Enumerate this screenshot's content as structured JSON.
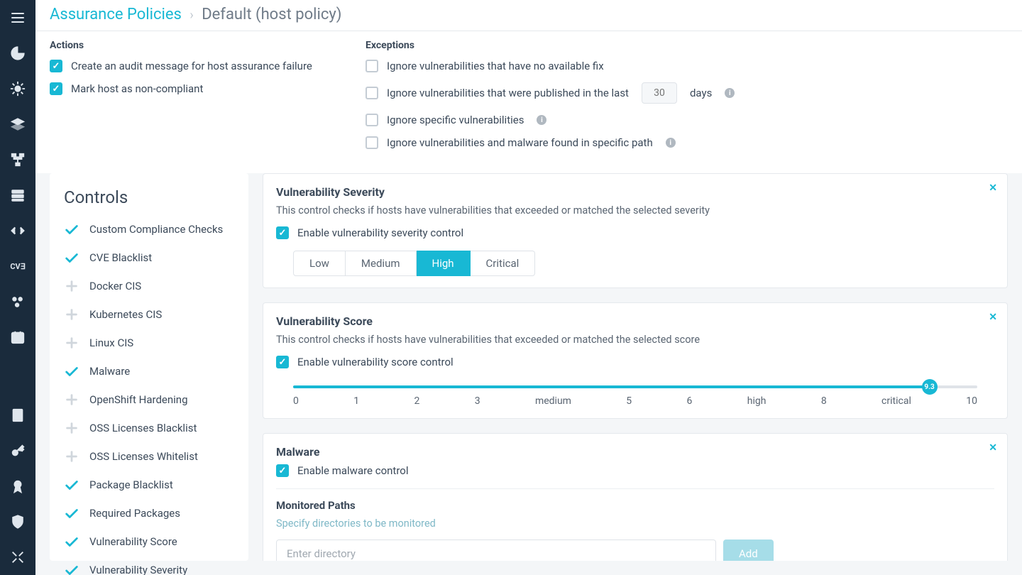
{
  "breadcrumb": {
    "root": "Assurance Policies",
    "current": "Default (host policy)"
  },
  "actions": {
    "heading": "Actions",
    "items": [
      {
        "label": "Create an audit message for host assurance failure",
        "checked": true
      },
      {
        "label": "Mark host as non-compliant",
        "checked": true
      }
    ]
  },
  "exceptions": {
    "heading": "Exceptions",
    "items": [
      {
        "label": "Ignore vulnerabilities that have no available fix",
        "checked": false
      },
      {
        "label_pre": "Ignore vulnerabilities that were published in the last",
        "days_placeholder": "30",
        "label_post": "days",
        "checked": false,
        "has_days": true,
        "has_info": true
      },
      {
        "label": "Ignore specific vulnerabilities",
        "checked": false,
        "has_info": true
      },
      {
        "label": "Ignore vulnerabilities and malware found in specific path",
        "checked": false,
        "has_info": true
      }
    ]
  },
  "controls_panel": {
    "heading": "Controls",
    "items": [
      {
        "label": "Custom Compliance Checks",
        "enabled": true
      },
      {
        "label": "CVE Blacklist",
        "enabled": true
      },
      {
        "label": "Docker CIS",
        "enabled": false
      },
      {
        "label": "Kubernetes CIS",
        "enabled": false
      },
      {
        "label": "Linux CIS",
        "enabled": false
      },
      {
        "label": "Malware",
        "enabled": true
      },
      {
        "label": "OpenShift Hardening",
        "enabled": false
      },
      {
        "label": "OSS Licenses Blacklist",
        "enabled": false
      },
      {
        "label": "OSS Licenses Whitelist",
        "enabled": false
      },
      {
        "label": "Package Blacklist",
        "enabled": true
      },
      {
        "label": "Required Packages",
        "enabled": true
      },
      {
        "label": "Vulnerability Score",
        "enabled": true
      },
      {
        "label": "Vulnerability Severity",
        "enabled": true
      }
    ]
  },
  "cards": {
    "severity": {
      "title": "Vulnerability Severity",
      "desc": "This control checks if hosts have vulnerabilities that exceeded or matched the selected severity",
      "enable_label": "Enable vulnerability severity control",
      "levels": [
        "Low",
        "Medium",
        "High",
        "Critical"
      ],
      "selected": "High"
    },
    "score": {
      "title": "Vulnerability Score",
      "desc": "This control checks if hosts have vulnerabilities that exceeded or matched the selected score",
      "enable_label": "Enable vulnerability score control",
      "value": 9.3,
      "value_label": "9.3",
      "ticks": [
        "0",
        "1",
        "2",
        "3",
        "medium",
        "5",
        "6",
        "high",
        "8",
        "critical",
        "10"
      ]
    },
    "malware": {
      "title": "Malware",
      "enable_label": "Enable malware control",
      "subhead": "Monitored Paths",
      "hint": "Specify directories to be monitored",
      "input_placeholder": "Enter directory",
      "add_label": "Add"
    }
  },
  "sidebar_icons": [
    "menu",
    "pie",
    "helm",
    "layers",
    "flow",
    "server",
    "code",
    "cve",
    "molecule",
    "calendar",
    "doc",
    "key",
    "badge",
    "shield",
    "tools"
  ]
}
